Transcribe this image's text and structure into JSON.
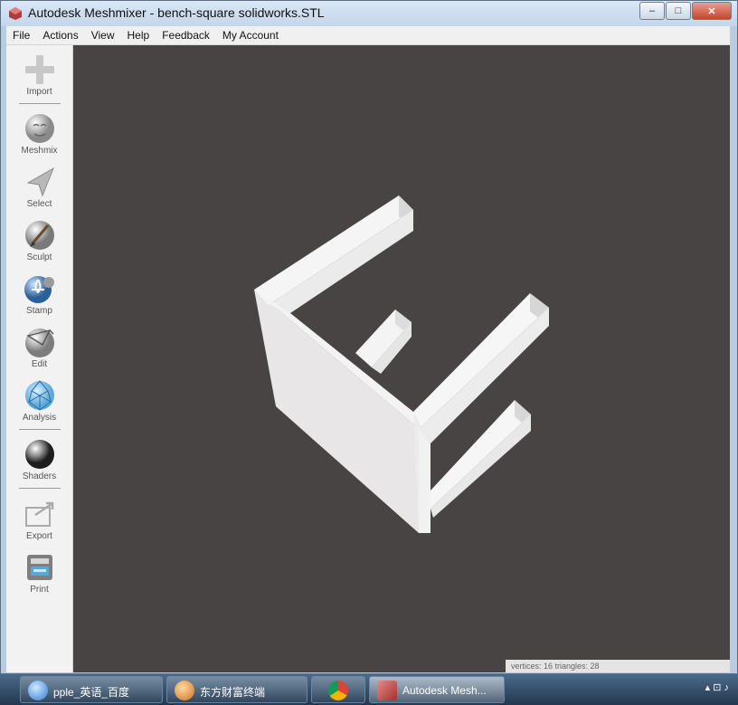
{
  "window": {
    "title": "Autodesk Meshmixer - bench-square solidworks.STL",
    "controls": {
      "minimize": "–",
      "maximize": "□",
      "close": "✕"
    }
  },
  "menu": [
    "File",
    "Actions",
    "View",
    "Help",
    "Feedback",
    "My Account"
  ],
  "toolbar": [
    {
      "label": "Import",
      "icon": "import-icon"
    },
    {
      "label": "Meshmix",
      "icon": "meshmix-icon"
    },
    {
      "label": "Select",
      "icon": "select-icon"
    },
    {
      "label": "Sculpt",
      "icon": "sculpt-icon"
    },
    {
      "label": "Stamp",
      "icon": "stamp-icon"
    },
    {
      "label": "Edit",
      "icon": "edit-icon"
    },
    {
      "label": "Analysis",
      "icon": "analysis-icon"
    },
    {
      "label": "Shaders",
      "icon": "shaders-icon"
    },
    {
      "label": "Export",
      "icon": "export-icon"
    },
    {
      "label": "Print",
      "icon": "print-icon"
    }
  ],
  "viewport": {
    "background": "#474443",
    "model_color": "#f2f2f2",
    "status_text": "vertices: 16  triangles: 28"
  },
  "taskbar": {
    "tasks": [
      {
        "label": "pple_英语_百度",
        "icon": "browser-icon"
      },
      {
        "label": "东方财富终端",
        "icon": "finance-icon"
      },
      {
        "label": "",
        "icon": "chrome-icon"
      },
      {
        "label": "Autodesk Mesh...",
        "icon": "meshmixer-icon"
      }
    ]
  }
}
